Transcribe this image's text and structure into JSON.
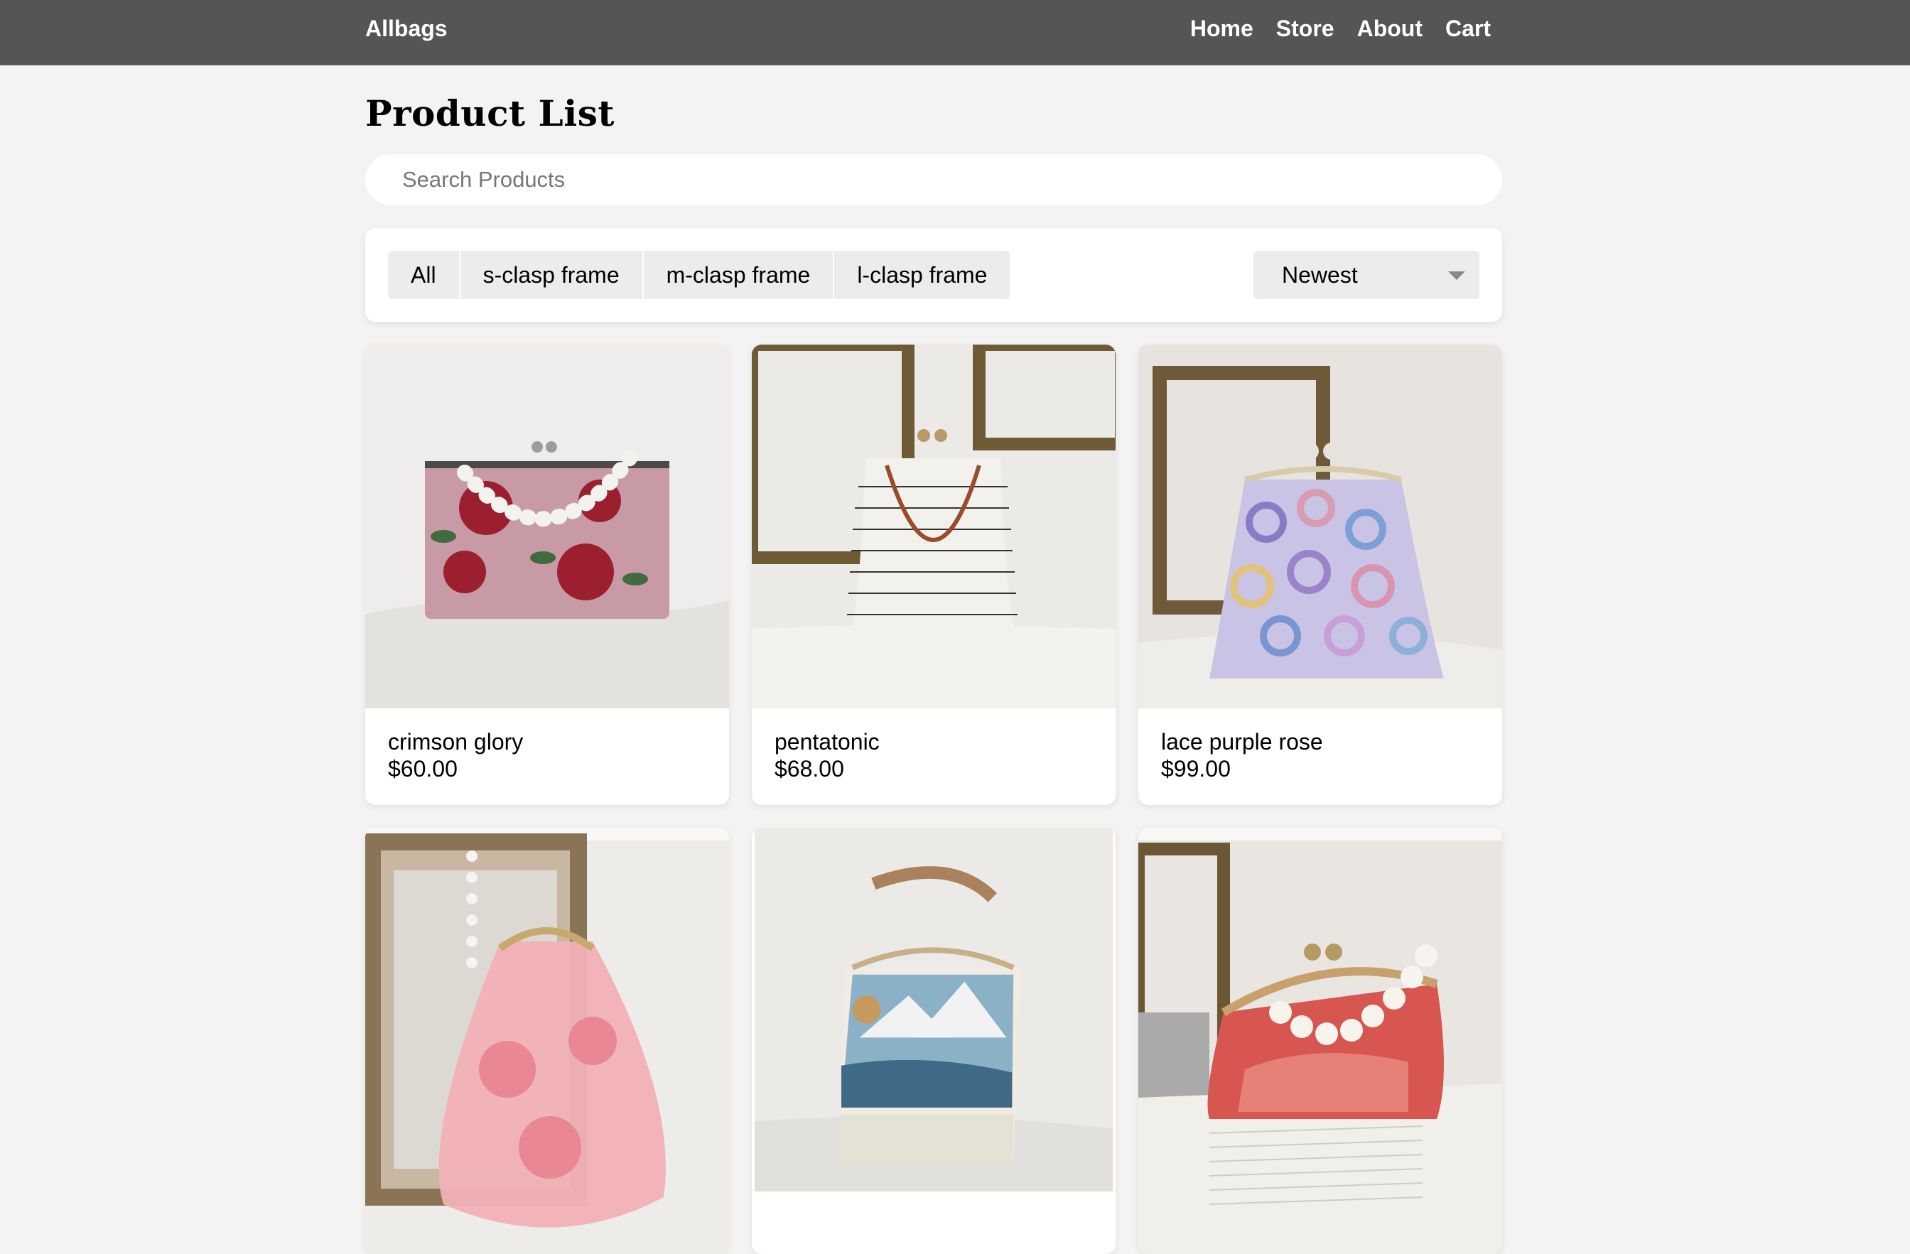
{
  "header": {
    "brand": "Allbags",
    "nav": [
      "Home",
      "Store",
      "About",
      "Cart"
    ]
  },
  "page": {
    "title": "Product List",
    "search_placeholder": "Search Products"
  },
  "filters": {
    "options": [
      "All",
      "s-clasp frame",
      "m-clasp frame",
      "l-clasp frame"
    ],
    "sort_selected": "Newest"
  },
  "products": [
    {
      "name": "crimson glory",
      "price": "$60.00"
    },
    {
      "name": "pentatonic",
      "price": "$68.00"
    },
    {
      "name": "lace purple rose",
      "price": "$99.00"
    },
    {
      "name": "",
      "price": ""
    },
    {
      "name": "",
      "price": ""
    },
    {
      "name": "",
      "price": ""
    }
  ],
  "colors": {
    "header_bg": "#555555",
    "page_bg": "#f3f3f3",
    "chip_bg": "#ececec"
  }
}
